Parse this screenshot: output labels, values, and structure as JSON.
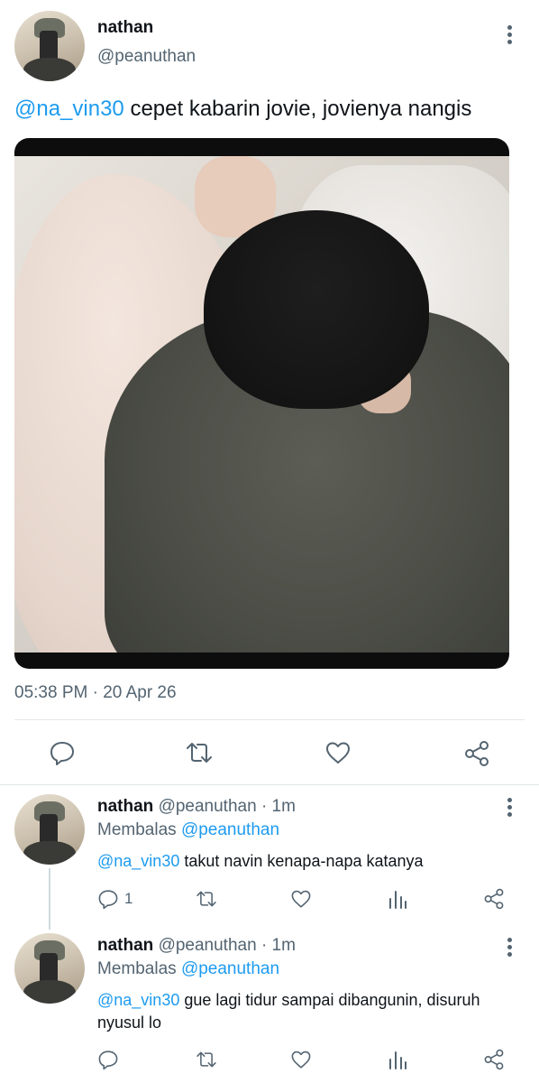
{
  "main_tweet": {
    "author_name": "nathan",
    "author_handle": "@peanuthan",
    "mention": "@na_vin30",
    "text": " cepet kabarin jovie, jovienya nangis",
    "timestamp": "05:38 PM · 20 Apr 26",
    "actions": [
      "reply-icon",
      "retweet-icon",
      "like-icon",
      "share-icon"
    ]
  },
  "replies": [
    {
      "author_name": "nathan",
      "author_handle": "@peanuthan",
      "time": "· 1m",
      "replying_to_label": "Membalas",
      "replying_to_handle": "@peanuthan",
      "mention": "@na_vin30",
      "text_line1": " takut navin kenapa-napa katanya",
      "text_line2": "",
      "reply_count": "1"
    },
    {
      "author_name": "nathan",
      "author_handle": "@peanuthan",
      "time": "· 1m",
      "replying_to_label": "Membalas",
      "replying_to_handle": "@peanuthan",
      "mention": "@na_vin30",
      "text_line1": " gue lagi tidur sampai dibangunin, disuruh",
      "text_line2": "nyusul lo",
      "reply_count": ""
    }
  ],
  "colors": {
    "link": "#1d9bf0",
    "secondary_text": "#536471",
    "primary_text": "#0f1419"
  }
}
